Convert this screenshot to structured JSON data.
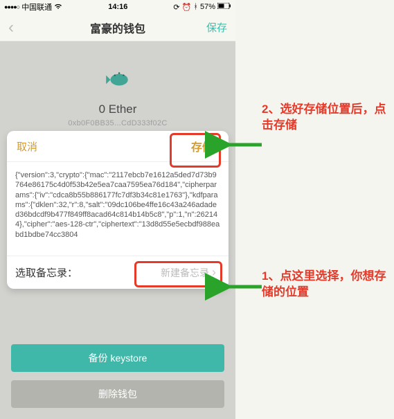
{
  "status": {
    "signal_dots": "●●●●○",
    "carrier": "中国联通",
    "wifi_icon": "wifi",
    "time": "14:16",
    "right_icons": "⟳ ⚙ ✱",
    "battery_pct": "57%",
    "battery_icon": "battery"
  },
  "nav": {
    "back_icon": "‹",
    "title": "富豪的钱包",
    "save_label": "保存"
  },
  "wallet": {
    "icon_name": "fish-icon",
    "balance": "0 Ether",
    "address": "0xb0F0BB35...CdD333f02C"
  },
  "buttons": {
    "backup": "备份 keystore",
    "delete": "删除钱包"
  },
  "sheet": {
    "cancel": "取消",
    "save": "存储",
    "body": "{\"version\":3,\"crypto\":{\"mac\":\"2117ebcb7e1612a5ded7d73b9764e86175c4d0f53b42e5ea7caa7595ea76d184\",\"cipherparams\":{\"iv\":\"cdca8b55b886177fc7df3b34c81e1763\"},\"kdfparams\":{\"dklen\":32,\"r\":8,\"salt\":\"09dc106be4ffe16c43a246adaded36bdcdf9b477f849ff8acad64c814b14b5c8\",\"p\":1,\"n\":262144},\"cipher\":\"aes-128-ctr\",\"ciphertext\":\"13d8d55e5ecbdf988eabd1bdbe74cc3804",
    "footer_label": "选取备忘录：",
    "memo_btn": "新建备忘录"
  },
  "annotations": {
    "step2": "2、选好存储位置后，点击存储",
    "step1": "1、点这里选择，你想存储的位置"
  }
}
